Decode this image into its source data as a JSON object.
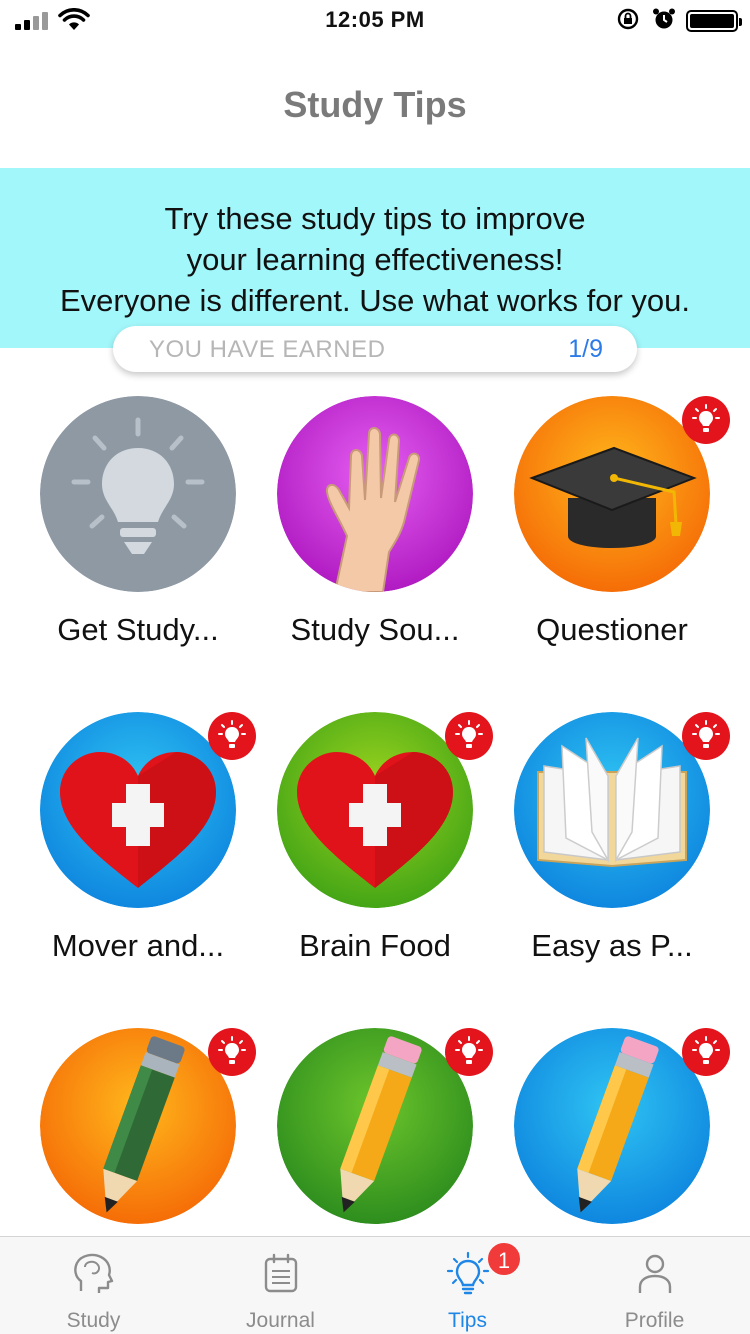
{
  "status_bar": {
    "time": "12:05 PM"
  },
  "header": {
    "title": "Study Tips"
  },
  "banner": {
    "lines": [
      "Try these study tips to improve",
      "your learning effectiveness!",
      "Everyone is different. Use what works for you."
    ]
  },
  "earned": {
    "label": "YOU HAVE EARNED",
    "count": "1/9"
  },
  "tips": [
    {
      "label": "Get Study...",
      "icon": "lightbulb-icon",
      "new": false
    },
    {
      "label": "Study Sou...",
      "icon": "hand-icon",
      "new": false
    },
    {
      "label": "Questioner",
      "icon": "graduation-cap-icon",
      "new": true
    },
    {
      "label": "Mover and...",
      "icon": "heart-cross-icon",
      "new": true
    },
    {
      "label": "Brain Food",
      "icon": "heart-cross-icon",
      "new": true
    },
    {
      "label": "Easy as P...",
      "icon": "book-icon",
      "new": true
    },
    {
      "label": "",
      "icon": "pencil-icon",
      "new": true
    },
    {
      "label": "",
      "icon": "pencil-icon",
      "new": true
    },
    {
      "label": "",
      "icon": "pencil-icon",
      "new": true
    }
  ],
  "tab_bar": {
    "tabs": [
      {
        "label": "Study",
        "icon": "head-icon",
        "active": false
      },
      {
        "label": "Journal",
        "icon": "journal-icon",
        "active": false
      },
      {
        "label": "Tips",
        "icon": "lightbulb-icon",
        "active": true,
        "badge": "1"
      },
      {
        "label": "Profile",
        "icon": "person-icon",
        "active": false
      }
    ]
  },
  "colors": {
    "banner": "#a2f7fa",
    "accent": "#1e86e6",
    "badge": "#e3141b"
  }
}
